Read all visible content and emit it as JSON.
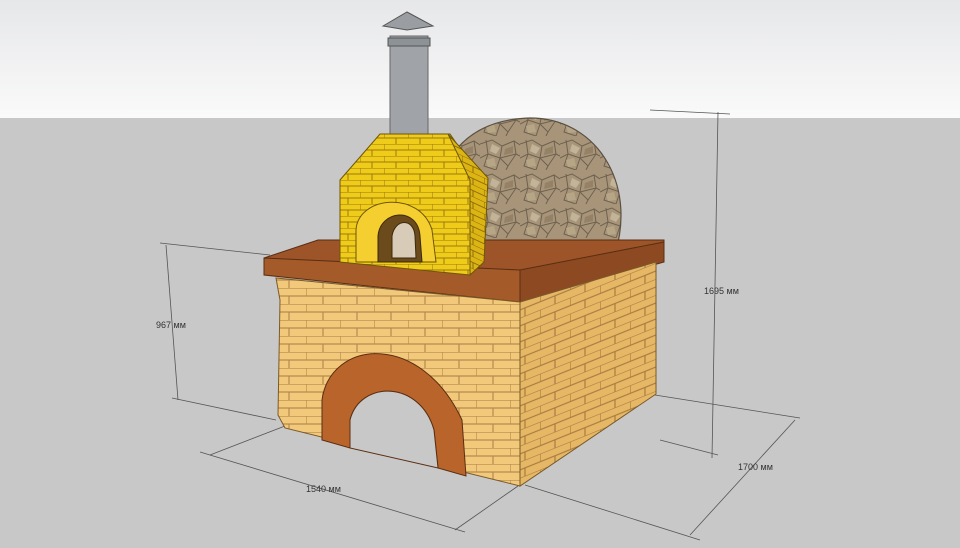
{
  "dimensions": {
    "width_label": "1540 мм",
    "depth_label": "1700 мм",
    "total_height_label": "1695 мм",
    "base_height_label": "967 мм"
  },
  "colors": {
    "sky_top": "#e9eaec",
    "sky_bottom": "#ffffff",
    "ground": "#c8c8c8",
    "base_brick": "#f2c97a",
    "base_mortar": "#b58a4d",
    "countertop": "#a55a2a",
    "arch_brick": "#b9642b",
    "portal_brick": "#f0cc1a",
    "dome_stone": "#a89579",
    "chimney": "#a0a4a8"
  }
}
